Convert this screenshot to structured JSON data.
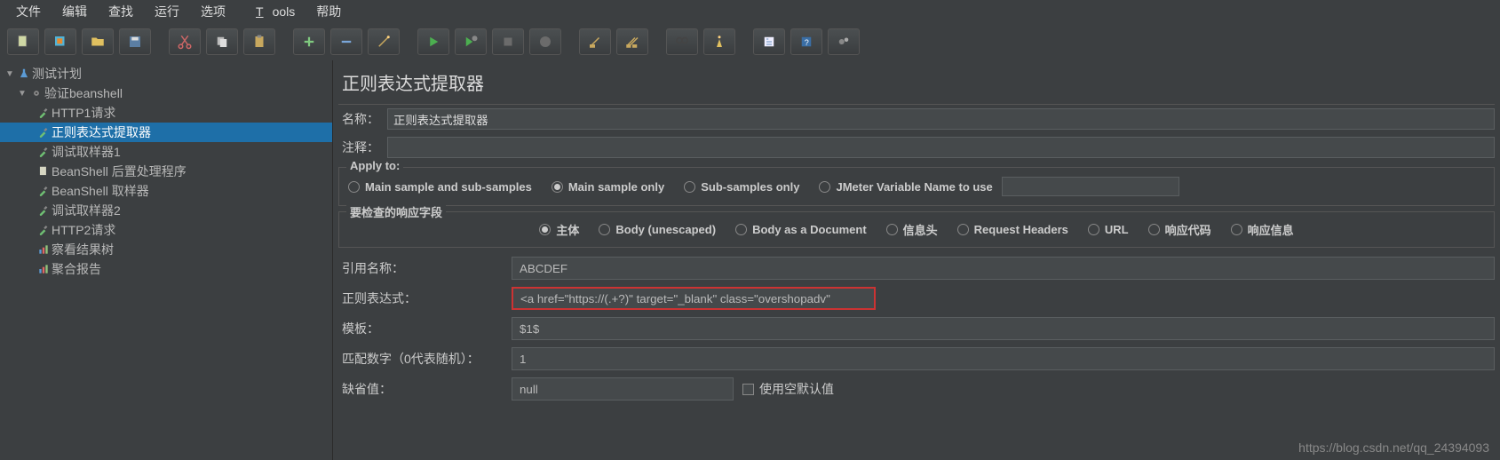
{
  "menu": {
    "file": "文件",
    "edit": "编辑",
    "find": "查找",
    "run": "运行",
    "options": "选项",
    "tools": "Tools",
    "help": "帮助"
  },
  "tree": {
    "root": "测试计划",
    "thread": "验证beanshell",
    "items": [
      {
        "icon": "pipette",
        "label": "HTTP1请求"
      },
      {
        "icon": "pipette",
        "label": "正则表达式提取器",
        "selected": true
      },
      {
        "icon": "pipette",
        "label": "调试取样器1"
      },
      {
        "icon": "doc",
        "label": "BeanShell 后置处理程序"
      },
      {
        "icon": "pipette",
        "label": "BeanShell 取样器"
      },
      {
        "icon": "pipette",
        "label": "调试取样器2"
      },
      {
        "icon": "pipette",
        "label": "HTTP2请求"
      },
      {
        "icon": "chart",
        "label": "察看结果树"
      },
      {
        "icon": "chart",
        "label": "聚合报告"
      }
    ]
  },
  "panel": {
    "title": "正则表达式提取器",
    "name_label": "名称：",
    "name_value": "正则表达式提取器",
    "comment_label": "注释：",
    "comment_value": "",
    "apply_to": {
      "legend": "Apply to:",
      "main_sub": "Main sample and sub-samples",
      "main_only": "Main sample only",
      "sub_only": "Sub-samples only",
      "jvar": "JMeter Variable Name to use",
      "selected": "main_only"
    },
    "field": {
      "legend": "要检查的响应字段",
      "body": "主体",
      "body_un": "Body (unescaped)",
      "body_doc": "Body as a Document",
      "headers": "信息头",
      "req_headers": "Request Headers",
      "url": "URL",
      "code": "响应代码",
      "msg": "响应信息",
      "selected": "body"
    },
    "kv": {
      "refname_label": "引用名称：",
      "refname": "ABCDEF",
      "regex_label": "正则表达式：",
      "regex": "<a href=\"https://(.+?)\" target=\"_blank\" class=\"overshopadv\"",
      "template_label": "模板：",
      "template": "$1$",
      "match_label": "匹配数字（0代表随机）：",
      "match": "1",
      "default_label": "缺省值：",
      "default": "null",
      "use_empty": "使用空默认值"
    }
  },
  "watermark": "https://blog.csdn.net/qq_24394093"
}
